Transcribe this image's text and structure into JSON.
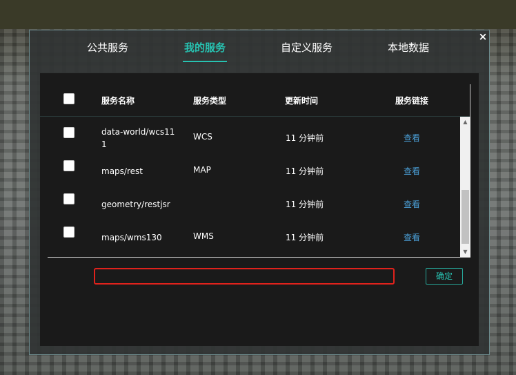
{
  "dialog": {
    "close_symbol": "×",
    "tabs": [
      {
        "label": "公共服务",
        "active": false
      },
      {
        "label": "我的服务",
        "active": true
      },
      {
        "label": "自定义服务",
        "active": false
      },
      {
        "label": "本地数据",
        "active": false
      }
    ]
  },
  "table": {
    "headers": {
      "name": "服务名称",
      "type": "服务类型",
      "updated": "更新时间",
      "link": "服务链接"
    },
    "rows": [
      {
        "checked": false,
        "name": "data-world/wcs111",
        "type": "WCS",
        "updated": "11 分钟前",
        "link": "查看"
      },
      {
        "checked": false,
        "name": "maps/rest",
        "type": "MAP",
        "updated": "11 分钟前",
        "link": "查看"
      },
      {
        "checked": false,
        "name": "geometry/restjsr",
        "type": "",
        "updated": "11 分钟前",
        "link": "查看"
      },
      {
        "checked": false,
        "name": "maps/wms130",
        "type": "WMS",
        "updated": "11 分钟前",
        "link": "查看"
      }
    ]
  },
  "footer": {
    "url_input_value": "",
    "url_input_placeholder": "",
    "confirm_label": "确定"
  },
  "colors": {
    "accent": "#27c2b1",
    "link": "#4ba0d8",
    "highlight_border": "#e0221c"
  }
}
